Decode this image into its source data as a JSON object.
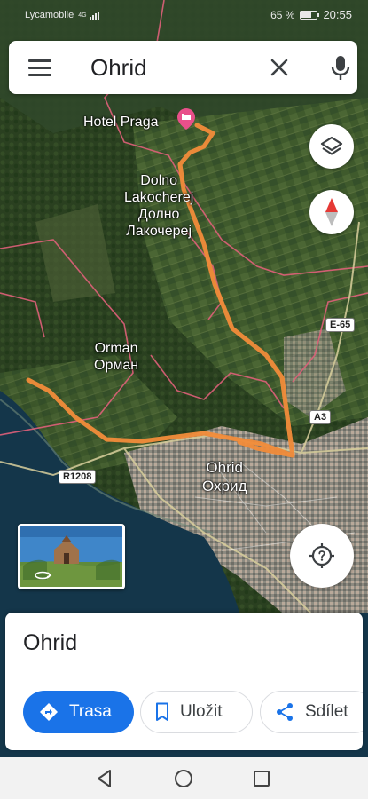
{
  "status_bar": {
    "carrier": "Lycamobile",
    "network": "4G",
    "battery": "65 %",
    "battery_level": 0.65,
    "time": "20:55"
  },
  "search": {
    "value": "Ohrid",
    "menu_icon": "menu-icon",
    "clear_icon": "close-icon",
    "mic_icon": "mic-icon"
  },
  "map": {
    "hotel": "Hotel Praga",
    "village_line1": "Dolno",
    "village_line2": "Lakocherej",
    "village_line3": "Долно",
    "village_line4": "Лакочереј",
    "orman_line1": "Orman",
    "orman_line2": "Орман",
    "city_line1": "Ohrid",
    "city_line2": "Охрид",
    "road_e65": "E-65",
    "road_a3": "A3",
    "road_r1208": "R1208",
    "route_color": "#f28c3a",
    "border_color": "#e0607a"
  },
  "controls": {
    "layers_icon": "layers-icon",
    "compass_icon": "compass-icon",
    "location_icon": "my-location-icon"
  },
  "place_card": {
    "title": "Ohrid",
    "directions_label": "Trasa",
    "save_label": "Uložit",
    "share_label": "Sdílet",
    "accent": "#1a73e8"
  },
  "nav_bar": {
    "back_icon": "back-triangle-icon",
    "home_icon": "home-circle-icon",
    "recents_icon": "recents-square-icon"
  }
}
